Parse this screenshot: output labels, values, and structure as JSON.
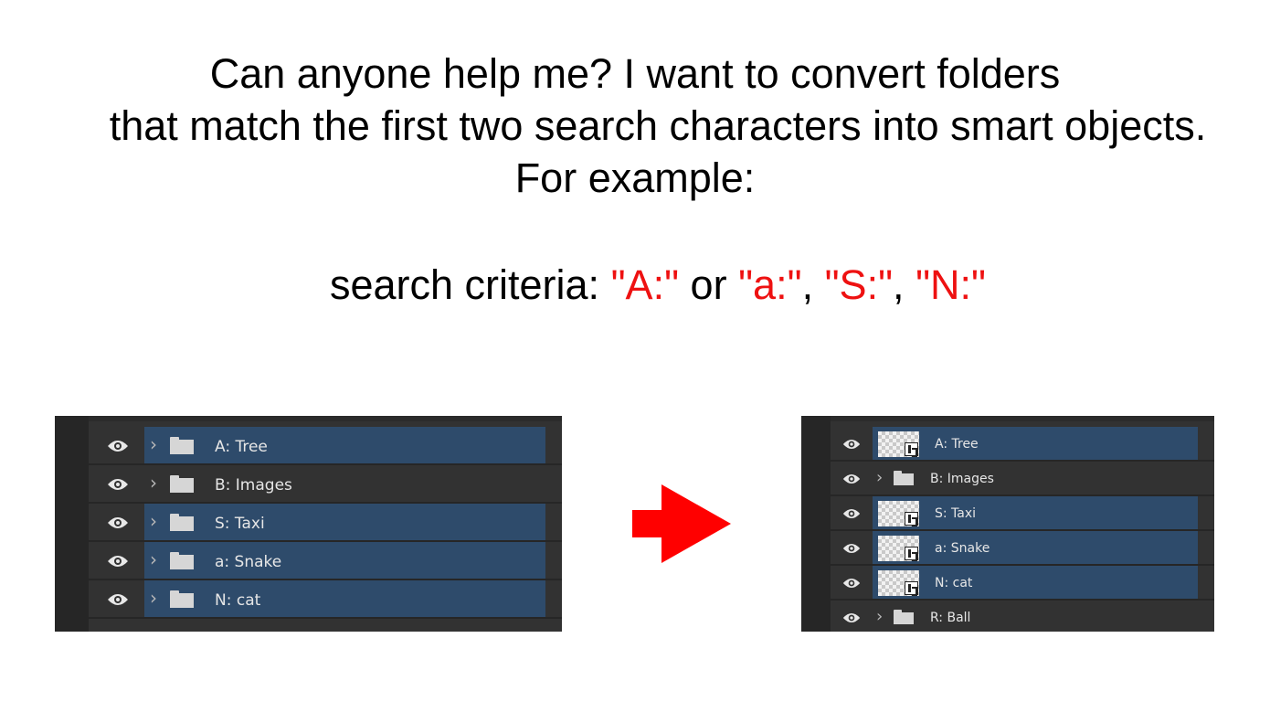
{
  "question": {
    "line1": "Can anyone help me? I want to convert folders",
    "line2": "that match the first two search characters into smart objects.",
    "line3": "For example:"
  },
  "criteria": {
    "label": "search criteria: ",
    "term1": "\"A:\"",
    "or_word": " or ",
    "term2": "\"a:\"",
    "sep1": ", ",
    "term3": "\"S:\"",
    "sep2": ", ",
    "term4": "\"N:\"",
    "highlight_color": "#ee1111"
  },
  "before_panel": {
    "layers": [
      {
        "name": "A: Tree",
        "selected": true,
        "type": "folder"
      },
      {
        "name": "B: Images",
        "selected": false,
        "type": "folder"
      },
      {
        "name": "S: Taxi",
        "selected": true,
        "type": "folder"
      },
      {
        "name": "a: Snake",
        "selected": true,
        "type": "folder"
      },
      {
        "name": "N: cat",
        "selected": true,
        "type": "folder"
      }
    ]
  },
  "after_panel": {
    "layers": [
      {
        "name": "A: Tree",
        "selected": true,
        "type": "smart-object"
      },
      {
        "name": "B: Images",
        "selected": false,
        "type": "folder"
      },
      {
        "name": "S: Taxi",
        "selected": true,
        "type": "smart-object"
      },
      {
        "name": "a: Snake",
        "selected": true,
        "type": "smart-object"
      },
      {
        "name": "N: cat",
        "selected": true,
        "type": "smart-object"
      },
      {
        "name": "R: Ball",
        "selected": false,
        "type": "folder"
      }
    ]
  },
  "colors": {
    "panel_bg": "#323232",
    "selection": "#2e4b6b",
    "arrow": "#ff0000"
  },
  "icons": {
    "visibility": "eye-icon",
    "expand": "chevron-right-icon",
    "group": "folder-icon",
    "smart_object": "smart-object-thumbnail-icon",
    "transition": "arrow-right-icon"
  }
}
